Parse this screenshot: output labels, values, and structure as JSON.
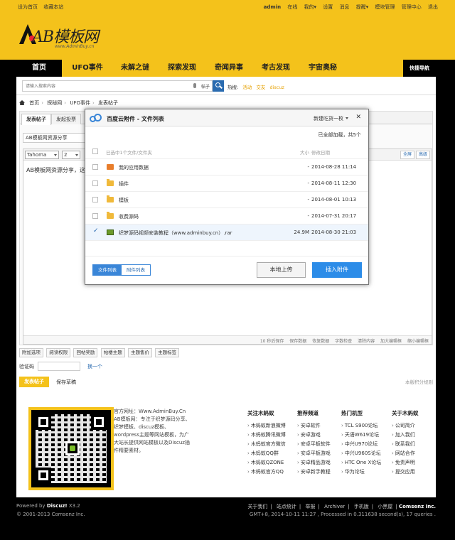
{
  "topbar": {
    "left_links": [
      "设为首页",
      "收藏本站"
    ],
    "user": "admin",
    "right_links": [
      "在线",
      "我的▾",
      "设置",
      "消息",
      "提醒▾",
      "模块管理",
      "管理中心",
      "退出"
    ]
  },
  "logo": {
    "text": "AB模板网",
    "url": "www.AdminBuy.cn"
  },
  "nav": {
    "items": [
      "首页",
      "UFO事件",
      "未解之谜",
      "探索发现",
      "奇闻异事",
      "考古发现",
      "宇宙奥秘"
    ],
    "quick": "快捷导航"
  },
  "search": {
    "placeholder": "请输入搜索内容",
    "type": "帖子",
    "hot_label": "热搜:",
    "hot_keywords": [
      "活动",
      "交友",
      "discuz"
    ]
  },
  "breadcrumb": [
    "首页",
    "探秘网",
    "UFO事件",
    "发表帖子"
  ],
  "post": {
    "tabs": [
      "发表帖子",
      "发起投票"
    ],
    "subject": "AB模板网资源分享",
    "font": "Tahoma",
    "size": "2",
    "fullscreen": "全屏",
    "advanced": "高级",
    "content": "AB模板网资源分享，这里",
    "status_items": [
      "10 秒后保存",
      "保存数据",
      "恢复数据",
      "字数检查",
      "清除内容",
      "加大编辑框",
      "缩小编辑框"
    ],
    "options": [
      "附加选项",
      "阅读权限",
      "回帖奖励",
      "帖楼主题",
      "主题售价",
      "主题标签"
    ],
    "captcha_label": "验证码",
    "captcha_swap": "换一个",
    "submit": "发表帖子",
    "save_draft": "保存草稿",
    "rules": "本版积分规则"
  },
  "modal": {
    "title": "百度云附件 - 文件列表",
    "account": "新建吃货一枚",
    "close": "✕",
    "loaded": "已全部加载，共5个",
    "header": {
      "name": "已选中1个文件/文件夹",
      "size": "大小",
      "date": "修改日期"
    },
    "files": [
      {
        "name": "我的应用数据",
        "size": "-",
        "date": "2014-08-28 11:14",
        "icon": "app-data-icon",
        "selected": false
      },
      {
        "name": "插件",
        "size": "-",
        "date": "2014-08-11 12:30",
        "icon": "folder-icon",
        "selected": false
      },
      {
        "name": "模板",
        "size": "-",
        "date": "2014-08-01 10:13",
        "icon": "folder-icon",
        "selected": false
      },
      {
        "name": "收费源码",
        "size": "-",
        "date": "2014-07-31 20:17",
        "icon": "folder-icon",
        "selected": false
      },
      {
        "name": "织梦源码视频安装教程（www.adminbuy.cn）.rar",
        "size": "24.9M",
        "date": "2014-08-30 21:03",
        "icon": "rar-icon",
        "selected": true
      }
    ],
    "view_tabs": [
      "文件列表",
      "附件列表"
    ],
    "local_upload": "本地上传",
    "insert": "插入附件"
  },
  "footer": {
    "intro": "官方网址：Www.AdminBuy.Cn AB模板网：专注于织梦源码分享、织梦模板、discuz模板、wordpress主题等网站模板，为广大站长提供网站模板以及Discuz插件精要素材。",
    "columns": [
      {
        "title": "关注木蚂蚁",
        "items": [
          "木蚂蚁新浪微博",
          "木蚂蚁腾讯微博",
          "木蚂蚁官方微信",
          "木蚂蚁QQ群",
          "木蚂蚁QZONE",
          "木蚂蚁官方QQ"
        ]
      },
      {
        "title": "推荐频道",
        "items": [
          "安卓软件",
          "安卓游戏",
          "安卓平板软件",
          "安卓平板游戏",
          "安卓精品游戏",
          "安卓新手教程"
        ]
      },
      {
        "title": "热门机型",
        "items": [
          "TCL S900论坛",
          "天语W619论坛",
          "中兴U970论坛",
          "中兴U960S论坛",
          "HTC One X论坛",
          "华为论坛"
        ]
      },
      {
        "title": "关于木蚂蚁",
        "items": [
          "公司简介",
          "加入我们",
          "联系我们",
          "网站合作",
          "免责声明",
          "提交应用"
        ]
      }
    ]
  },
  "bottom": {
    "powered_prefix": "Powered by",
    "powered_name": "Discuz!",
    "powered_version": "X3.2",
    "copyright": "© 2001-2013 Comsenz Inc.",
    "links": [
      "关于我们",
      "站点统计",
      "举报",
      "Archiver",
      "手机版",
      "小黑屋"
    ],
    "company": "Comsenz Inc.",
    "stats": "GMT+8, 2014-10-11 11:27 , Processed in 0.311638 second(s), 17 queries ."
  },
  "colors": {
    "brand_yellow": "#f4c21b",
    "accent_blue": "#2c8ce8"
  }
}
